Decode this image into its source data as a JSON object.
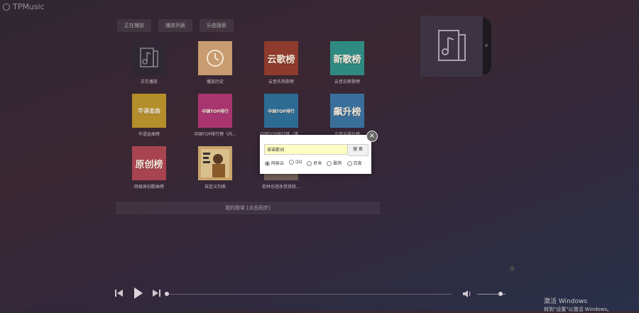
{
  "app": {
    "title": "TPMusic"
  },
  "tabs": [
    {
      "label": "正在播放"
    },
    {
      "label": "播放列表"
    },
    {
      "label": "乐曲搜索"
    }
  ],
  "tiles": [
    {
      "label": "正在播放",
      "cover_text": "",
      "color": "#2f2834",
      "icon": "music-doc-icon"
    },
    {
      "label": "播放历史",
      "cover_text": "",
      "color": "#c89b70",
      "icon": "clock-icon"
    },
    {
      "label": "云音乐热歌榜",
      "cover_text": "云歌榜",
      "color": "#8e3a2d",
      "icon": ""
    },
    {
      "label": "云音乐新歌榜",
      "cover_text": "新歌榜",
      "color": "#2f8a82",
      "icon": ""
    },
    {
      "label": "华语金曲榜",
      "cover_text": "华语金曲",
      "color": "#b48e2b",
      "icon": ""
    },
    {
      "label": "中国TOP排行榜（内...",
      "cover_text": "中国TOP排行",
      "color": "#a83570",
      "icon": ""
    },
    {
      "label": "中国TOP排行榜（港...",
      "cover_text": "中国TOP排行",
      "color": "#2d6b93",
      "icon": ""
    },
    {
      "label": "云音乐飙升榜",
      "cover_text": "飙升榜",
      "color": "#3a6f9b",
      "icon": ""
    },
    {
      "label": "网易原创歌曲榜",
      "cover_text": "原创榜",
      "color": "#a8444f",
      "icon": ""
    },
    {
      "label": "自定义列表",
      "cover_text": "",
      "color": "#c9a46a",
      "icon": "album-art-icon"
    },
    {
      "label": "街林乐团永受其机...",
      "cover_text": "",
      "color": "#6e5d55",
      "icon": "album-art-icon"
    }
  ],
  "sync_bar": {
    "label": "我的歌单 [点击同步]"
  },
  "now_playing": {
    "icon": "music-doc-icon"
  },
  "dialog": {
    "search_value": "诺诺歌词",
    "search_button": "搜 索",
    "sources": [
      {
        "label": "网易云",
        "selected": true
      },
      {
        "label": "QQ",
        "selected": false
      },
      {
        "label": "虾米",
        "selected": false
      },
      {
        "label": "酷狗",
        "selected": false
      },
      {
        "label": "百度",
        "selected": false
      }
    ]
  },
  "player": {
    "progress": 0.0,
    "volume": 0.8
  },
  "watermark": {
    "line1": "激活 Windows",
    "line2": "转到\"设置\"以激活 Windows。"
  }
}
